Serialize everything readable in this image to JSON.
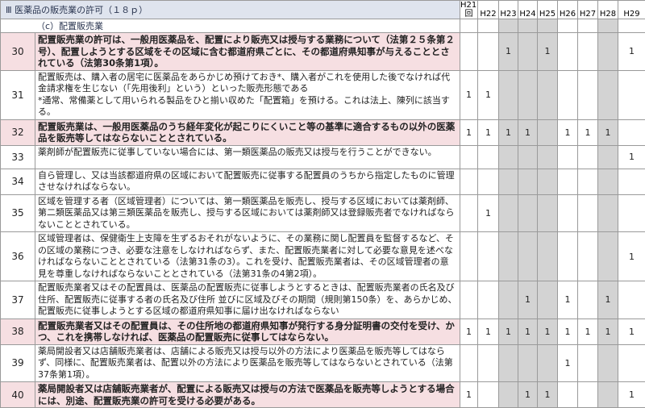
{
  "title": "Ⅲ 医薬品の販売業の許可（１８ｐ）",
  "subtitle": "（c）配置販売業",
  "years": [
    "H21.1回",
    "H22",
    "H23",
    "H24",
    "H25",
    "H26",
    "H27",
    "H28",
    "H29"
  ],
  "rows": [
    {
      "no": "30",
      "emph": true,
      "text": "配置販売業の許可は、一般用医薬品を、配置により販売又は授与する業務について（法第２５条第２号）、配置しようとする区域をその区域に含む都道府県ごとに、その都道府県知事が与えることとされている（法第30条第1項）。",
      "marks": [
        "",
        "",
        "1",
        "",
        "1",
        "",
        "",
        "",
        "1"
      ]
    },
    {
      "no": "31",
      "emph": false,
      "text": "配置販売は、購入者の居宅に医薬品をあらかじめ預けておき*、購入者がこれを使用した後でなければ代金請求権を生じない（「先用後利」という）といった販売形態である\n*通常、常備薬として用いられる製品をひと揃い収めた「配置箱」を預ける。これは法上、陳列に該当する。",
      "marks": [
        "1",
        "1",
        "",
        "",
        "",
        "",
        "",
        "",
        ""
      ]
    },
    {
      "no": "32",
      "emph": true,
      "text": "配置販売業は、一般用医薬品のうち経年変化が起こりにくいこと等の基準に適合するもの以外の医薬品を販売等してはならないこととされている。",
      "marks": [
        "1",
        "1",
        "1",
        "1",
        "",
        "1",
        "1",
        "1",
        ""
      ]
    },
    {
      "no": "33",
      "emph": false,
      "text": "薬剤師が配置販売に従事していない場合には、第一類医薬品の販売又は授与を行うことができない。",
      "marks": [
        "",
        "",
        "",
        "",
        "",
        "",
        "",
        "",
        "1"
      ]
    },
    {
      "no": "34",
      "emph": false,
      "text": "自ら管理し、又は当該都道府県の区域において配置販売に従事する配置員のうちから指定したものに管理させなければならない。",
      "marks": [
        "",
        "",
        "",
        "",
        "",
        "",
        "",
        "",
        ""
      ]
    },
    {
      "no": "35",
      "emph": false,
      "text": "区域を管理する者（区域管理者）については、第一類医薬品を販売し、授与する区域においては薬剤師、第二類医薬品又は第三類医薬品を販売し、授与する区域においては薬剤師又は登録販売者でなければならないこととされている。",
      "marks": [
        "",
        "1",
        "",
        "",
        "",
        "",
        "",
        "",
        ""
      ]
    },
    {
      "no": "36",
      "emph": false,
      "text": "区域管理者は、保健衛生上支障を生ずるおそれがないように、その業務に関し配置員を監督するなど、その区域の業務につき、必要な注意をしなければならず、また、配置販売業者に対して必要な意見を述べなければならないこととされている（法第31条の3）。これを受け、配置販売業者は、その区域管理者の意見を尊重しなければならないこととされている（法第31条の4第2項）。",
      "marks": [
        "",
        "",
        "",
        "",
        "",
        "",
        "",
        "",
        "1"
      ]
    },
    {
      "no": "37",
      "emph": false,
      "text": "配置販売業者又はその配置員は、医薬品の配置販売に従事しようとするときは、配置販売業者の氏名及び住所、配置販売に従事する者の氏名及び住所 並びに区域及びその期間（規則第150条）を、あらかじめ、配置販売に従事しようとする区域の都道府県知事に届け出なければならない",
      "marks": [
        "",
        "",
        "",
        "1",
        "",
        "1",
        "",
        "1",
        ""
      ]
    },
    {
      "no": "38",
      "emph": true,
      "text": "配置販売業者又はその配置員は、その住所地の都道府県知事が発行する身分証明書の交付を受け、かつ、これを携帯しなければ、医薬品の配置販売に従事してはならない。",
      "marks": [
        "1",
        "1",
        "1",
        "1",
        "1",
        "1",
        "1",
        "1",
        "1"
      ]
    },
    {
      "no": "39",
      "emph": false,
      "text": "薬局開設者又は店舗販売業者は、店舗による販売又は授与以外の方法により医薬品を販売等してはならず、同様に、配置販売業者は、配置以外の方法により医薬品を販売等してはならないとされている（法第37条第1項）。",
      "marks": [
        "",
        "",
        "",
        "",
        "",
        "1",
        "",
        "",
        ""
      ]
    },
    {
      "no": "40",
      "emph": true,
      "text": "薬局開設者又は店舗販売業者が、配置による販売又は授与の方法で医薬品を販売等しようとする場合には、別途、配置販売業の許可を受ける必要がある。",
      "marks": [
        "1",
        "",
        "",
        "1",
        "1",
        "",
        "",
        "",
        "1"
      ]
    }
  ]
}
